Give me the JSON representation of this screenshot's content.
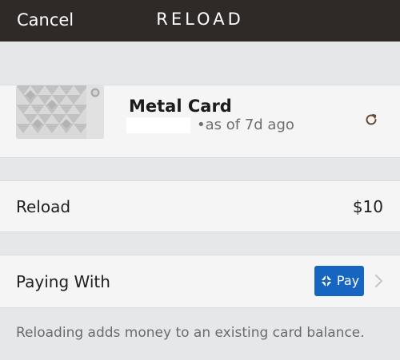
{
  "header": {
    "cancel_label": "Cancel",
    "title": "RELOAD"
  },
  "card": {
    "name": "Metal Card",
    "balance_note": "•as of 7d ago",
    "image_icon": "metal-card-image",
    "refresh_icon": "refresh-icon"
  },
  "reload": {
    "label": "Reload",
    "amount": "$10"
  },
  "payment": {
    "label": "Paying With",
    "method_label": "Pay",
    "method_icon": "chase-pay-icon",
    "accent_color": "#1665c1"
  },
  "footer": {
    "note": "Reloading adds money to an existing card balance."
  },
  "colors": {
    "header_bg": "#2f2a27",
    "page_bg": "#e6e7e9",
    "section_bg": "#f5f5f6",
    "refresh_color": "#6b4a2f"
  }
}
